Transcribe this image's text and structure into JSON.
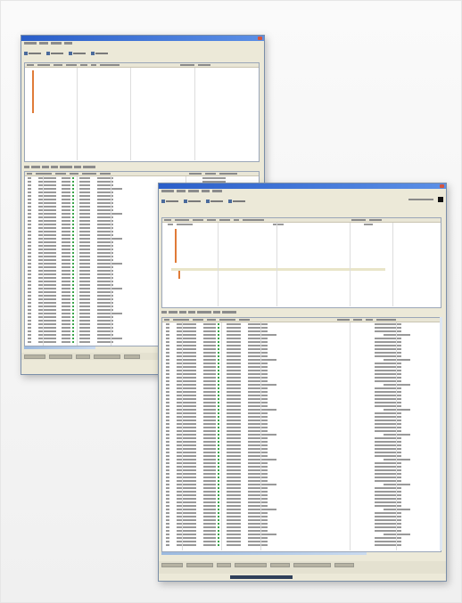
{
  "colors": {
    "titlebar": "#2a5ec9",
    "window_bg": "#ece9d8",
    "accent_orange": "#e07b38",
    "accent_green": "#3aa44a"
  },
  "window_back": {
    "icons": [
      "close-icon"
    ]
  },
  "window_front": {
    "icons": [
      "close-icon",
      "black-square-icon"
    ]
  }
}
